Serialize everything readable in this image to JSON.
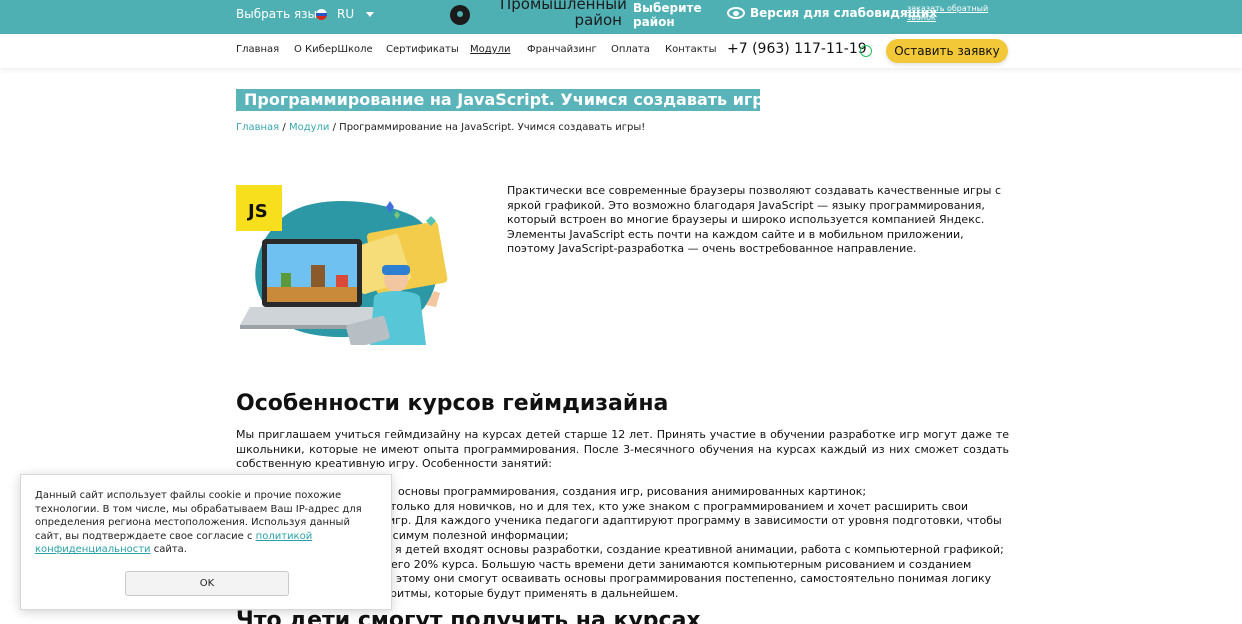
{
  "topbar": {
    "lang_label": "Выбрать язык",
    "lang_code": "RU",
    "district": "Промышленный район",
    "choose_district": "Выберите район",
    "low_vision": "Версия для слабовидящих",
    "callback": "заказать обратный звонок",
    "colors": {
      "bar": "#4fb0b4"
    }
  },
  "nav": {
    "items": [
      "Главная",
      "О КиберШколе",
      "Сертификаты",
      "Модули",
      "Франчайзинг",
      "Оплата",
      "Контакты"
    ],
    "active": "Модули",
    "phone": "+7 (963) 117-11-19",
    "order_button": "Оставить заявку"
  },
  "page": {
    "title": "Программирование на JavaScript. Учимся создавать игры!",
    "breadcrumb": {
      "home": "Главная",
      "modules": "Модули",
      "current": "Программирование на JavaScript. Учимся создавать игры!"
    },
    "js_badge": "JS",
    "intro": "Практически все современные браузеры позволяют создавать качественные игры с яркой графикой. Это возможно благодаря JavaScript — языку программирования, который встроен во многие браузеры и широко используется компанией Яндекс. Элементы JavaScript есть почти на каждом сайте и в мобильном приложении, поэтому JavaScript-разработка — очень востребованное направление.",
    "features_heading": "Особенности курсов геймдизайна",
    "features_intro": "Мы приглашаем учиться геймдизайну на курсах детей старше 12 лет. Принять участие в обучении разработке игр могут даже те школьники, которые не имеют опыта программирования. После 3-месячного обучения на курсах каждый из них сможет создать собственную креативную игру. Особенности занятий:",
    "bullets": [
      "основы программирования, создания игр, рисования анимированных картинок;",
      "только для новичков, но и для тех, кто уже знаком с программированием и хочет расширить свои",
      "игр. Для каждого ученика педагоги адаптируют программу в зависимости от уровня подготовки, чтобы",
      "ксимум полезной информации;",
      "я детей входят основы разработки, создание креативной анимации, работа с компьютерной графикой;",
      "его 20% курса. Большую часть времени дети занимаются компьютерным рисованием и созданием",
      "этому они смогут осваивать основы программирования постепенно, самостоятельно понимая логику",
      "ритмы, которые будут применять в дальнейшем."
    ],
    "next_heading": "Что дети смогут получить на курсах"
  },
  "cookie": {
    "text_before": "Данный сайт использует файлы cookie и прочие похожие технологии. В том числе, мы обрабатываем Ваш IP-адрес для определения региона местоположения. Используя данный сайт, вы подтверждаете свое согласие с ",
    "link": "политикой конфиденциальности",
    "text_after": " сайта.",
    "ok": "OK"
  }
}
